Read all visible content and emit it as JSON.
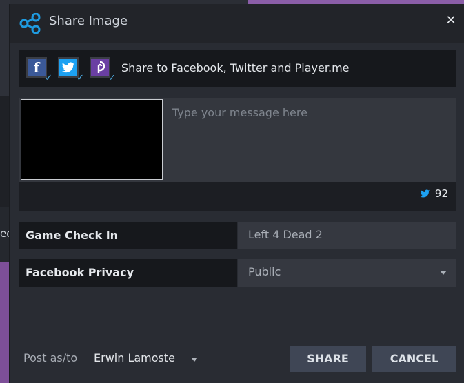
{
  "window": {
    "title": "Share Image"
  },
  "share_to": {
    "label": "Share to Facebook, Twitter and Player.me",
    "networks": [
      {
        "name": "Facebook",
        "icon": "facebook-icon",
        "checked": true,
        "color": "#3b5998"
      },
      {
        "name": "Twitter",
        "icon": "twitter-icon",
        "checked": true,
        "color": "#1da1f2"
      },
      {
        "name": "Player.me",
        "icon": "playerme-icon",
        "checked": true,
        "color": "#6a3fa3"
      }
    ]
  },
  "message": {
    "placeholder": "Type your message here",
    "value": "",
    "char_count": "92"
  },
  "game_check_in": {
    "label": "Game Check In",
    "value": "Left 4 Dead 2"
  },
  "facebook_privacy": {
    "label": "Facebook Privacy",
    "value": "Public"
  },
  "footer": {
    "post_as_label": "Post as/to",
    "user": "Erwin Lamoste",
    "share_label": "SHARE",
    "cancel_label": "CANCEL"
  },
  "colors": {
    "accent": "#4fb0e8",
    "button": "#3f4655"
  },
  "background": {
    "partial_glyph": "ee"
  }
}
